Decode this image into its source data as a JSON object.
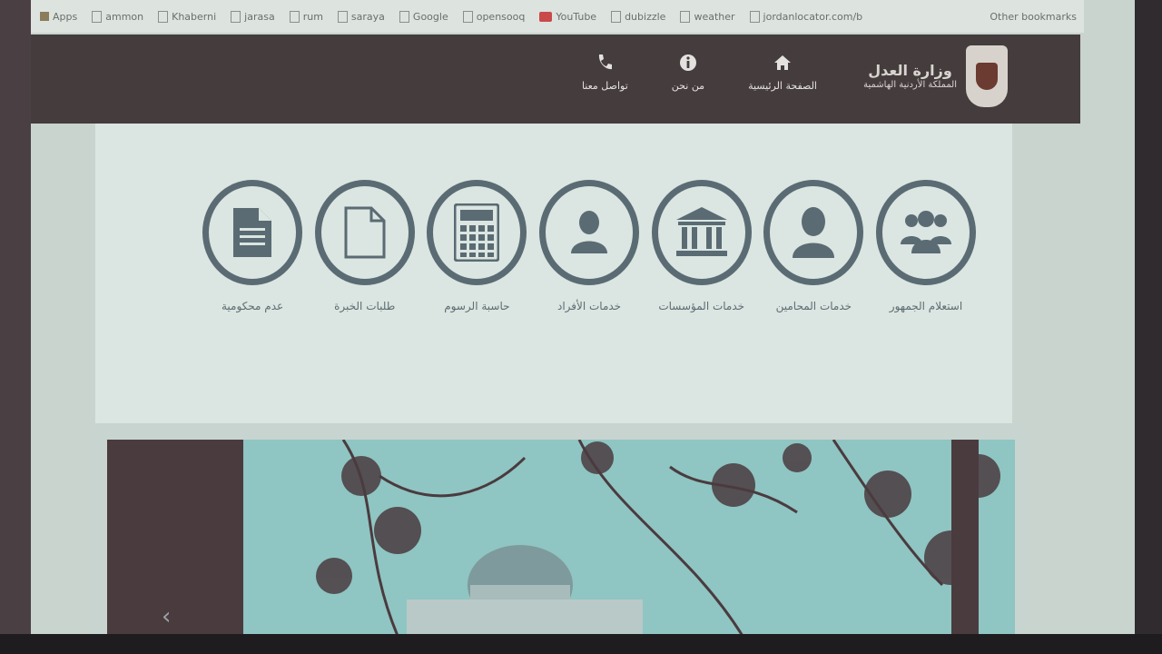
{
  "bookmarks": {
    "items": [
      {
        "label": "Apps",
        "icon": "apps-icon"
      },
      {
        "label": "ammon",
        "icon": "ammon-icon"
      },
      {
        "label": "Khaberni",
        "icon": "khaberni-icon"
      },
      {
        "label": "jarasa",
        "icon": "page-icon"
      },
      {
        "label": "rum",
        "icon": "page-icon"
      },
      {
        "label": "saraya",
        "icon": "page-icon"
      },
      {
        "label": "Google",
        "icon": "google-icon"
      },
      {
        "label": "opensooq",
        "icon": "opensooq-icon"
      },
      {
        "label": "YouTube",
        "icon": "youtube-icon"
      },
      {
        "label": "dubizzle",
        "icon": "dubizzle-icon"
      },
      {
        "label": "weather",
        "icon": "weather-icon"
      },
      {
        "label": "jordanlocator.com/b",
        "icon": "page-icon"
      }
    ],
    "other": "Other bookmarks"
  },
  "header": {
    "logo_line1": "وزارة العدل",
    "logo_line2": "المملكة الأردنية الهاشمية",
    "nav": [
      {
        "label": "الصفحة الرئيسية",
        "icon": "home-icon"
      },
      {
        "label": "من نحن",
        "icon": "info-icon"
      },
      {
        "label": "تواصل معنا",
        "icon": "phone-icon"
      }
    ]
  },
  "services": [
    {
      "label": "استعلام الجمهور",
      "icon": "group-icon"
    },
    {
      "label": "خدمات المحامين",
      "icon": "person-icon"
    },
    {
      "label": "خدمات المؤسسات",
      "icon": "institution-icon"
    },
    {
      "label": "خدمات الأفراد",
      "icon": "person-icon"
    },
    {
      "label": "حاسبة الرسوم",
      "icon": "calculator-icon"
    },
    {
      "label": "طلبات الخبرة",
      "icon": "document-icon"
    },
    {
      "label": "عدم محكومية",
      "icon": "document-icon"
    }
  ],
  "colors": {
    "header_bg": "#453c3e",
    "ring": "#5a6b73",
    "panel_bg": "#dbe5e1",
    "sky": "#8fc5c2"
  }
}
